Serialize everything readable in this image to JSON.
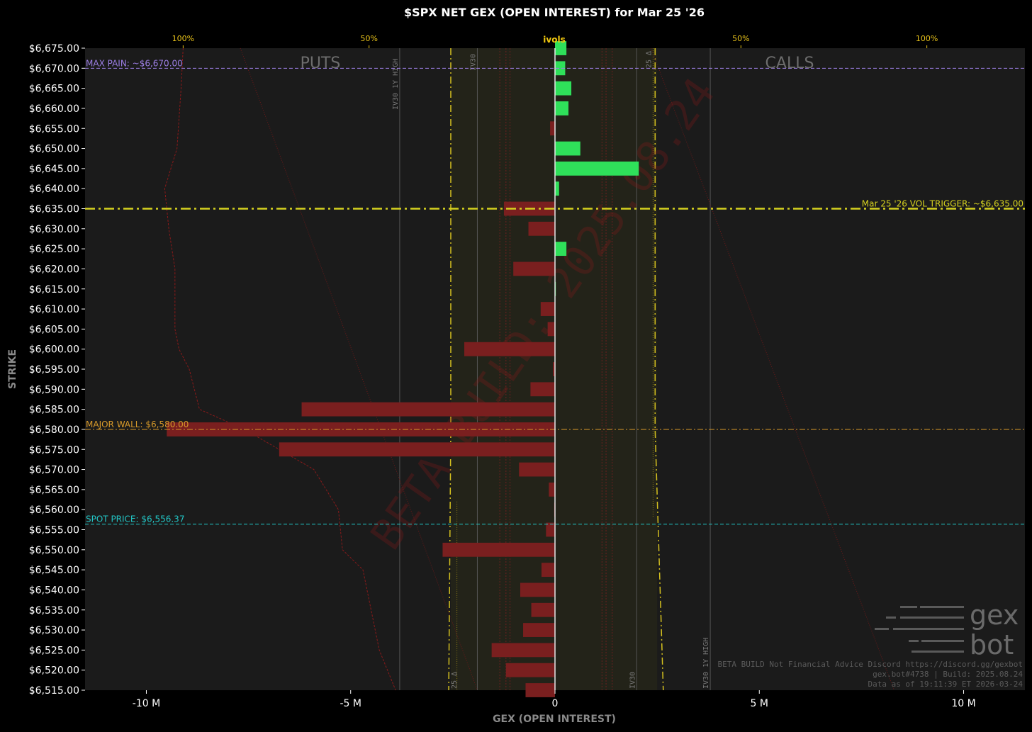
{
  "chart_data": {
    "type": "bar",
    "orientation": "horizontal",
    "title": "$SPX NET GEX (OPEN INTEREST) for Mar 25 '26",
    "xlabel": "GEX (OPEN INTEREST)",
    "ylabel": "STRIKE",
    "xlim": [
      -11.5,
      11.5
    ],
    "ylim": [
      6515,
      6675
    ],
    "x_ticks": [
      {
        "value": -10,
        "label": "-10 M"
      },
      {
        "value": -5,
        "label": "-5 M"
      },
      {
        "value": 0,
        "label": "0"
      },
      {
        "value": 5,
        "label": "5 M"
      },
      {
        "value": 10,
        "label": "10 M"
      }
    ],
    "y_tick_labels": [
      "$6,675.00",
      "$6,670.00",
      "$6,665.00",
      "$6,660.00",
      "$6,655.00",
      "$6,650.00",
      "$6,645.00",
      "$6,640.00",
      "$6,635.00",
      "$6,630.00",
      "$6,625.00",
      "$6,620.00",
      "$6,615.00",
      "$6,610.00",
      "$6,605.00",
      "$6,600.00",
      "$6,595.00",
      "$6,590.00",
      "$6,585.00",
      "$6,580.00",
      "$6,575.00",
      "$6,570.00",
      "$6,565.00",
      "$6,560.00",
      "$6,555.00",
      "$6,550.00",
      "$6,545.00",
      "$6,540.00",
      "$6,535.00",
      "$6,530.00",
      "$6,525.00",
      "$6,520.00",
      "$6,515.00"
    ],
    "top_axis": {
      "label": "ivols",
      "ticks": [
        {
          "value": -9.1,
          "label": "100%"
        },
        {
          "value": -4.55,
          "label": "50%"
        },
        {
          "value": 4.55,
          "label": "50%"
        },
        {
          "value": 9.1,
          "label": "100%"
        }
      ]
    },
    "side_labels": {
      "left": "PUTS",
      "right": "CALLS"
    },
    "strikes": [
      6675,
      6670,
      6665,
      6660,
      6655,
      6650,
      6645,
      6640,
      6635,
      6630,
      6625,
      6620,
      6615,
      6610,
      6605,
      6600,
      6595,
      6590,
      6585,
      6580,
      6575,
      6570,
      6565,
      6560,
      6555,
      6550,
      6545,
      6540,
      6535,
      6530,
      6525,
      6520,
      6515
    ],
    "values": [
      0.28,
      0.25,
      0.4,
      0.33,
      -0.12,
      0.62,
      2.05,
      0.1,
      -1.25,
      -0.65,
      0.28,
      -1.02,
      0.02,
      -0.35,
      -0.18,
      -2.22,
      -0.05,
      -0.6,
      -6.2,
      -9.5,
      -6.75,
      -0.88,
      -0.15,
      -0.02,
      -0.22,
      -2.75,
      -0.33,
      -0.85,
      -0.58,
      -0.78,
      -1.55,
      -1.2,
      -0.72
    ],
    "colors": {
      "positive": "#2fe05a",
      "negative": "#7a1f1f",
      "background": "#1a1a1a"
    },
    "levels": [
      {
        "name": "max_pain",
        "strike": 6670.0,
        "label": "MAX PAIN: ~$6,670.00",
        "color": "#9d7fe6",
        "style": "dashed"
      },
      {
        "name": "vol_trigger",
        "strike": 6635.0,
        "label": "Mar 25 '26 VOL TRIGGER: ~$6,635.00",
        "color": "#d6d21f",
        "style": "dashdot"
      },
      {
        "name": "major_wall",
        "strike": 6580.0,
        "label": "MAJOR WALL: $6,580.00",
        "color": "#d89a2a",
        "style": "dashdot-thin"
      },
      {
        "name": "spot_price",
        "strike": 6556.37,
        "label": "SPOT PRICE: $6,556.37",
        "color": "#22c6c6",
        "style": "dashed"
      }
    ],
    "iv_lines": [
      {
        "label": "IV30 1Y HIGH",
        "x": -3.8
      },
      {
        "label": "IV30",
        "x": -1.9
      },
      {
        "label": "IV30",
        "x": 2.0
      },
      {
        "label": "IV30 1Y HIGH",
        "x": 3.8
      }
    ],
    "delta_labels": [
      "25 Δ",
      "25 Δ"
    ],
    "watermark": "BETA BUILD: 2025.08.24",
    "footer_lines": [
      "BETA BUILD Not Financial Advice Discord https://discord.gg/gexbot",
      "gex.bot#4738 | Build: 2025.08.24",
      "Data as of 19:11:39 ET 2026-03-24"
    ],
    "logo": {
      "line1": "gex",
      "line2": "bot"
    }
  }
}
